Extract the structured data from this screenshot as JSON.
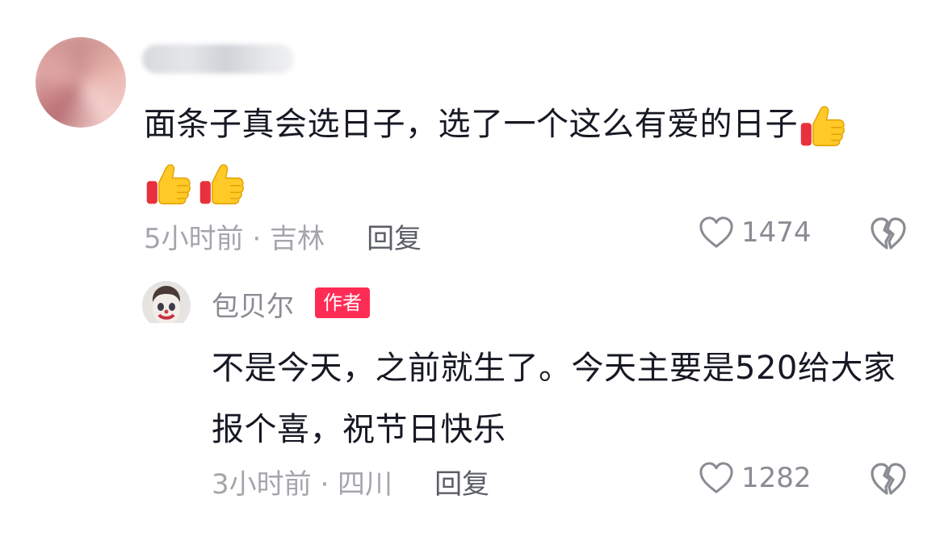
{
  "comment": {
    "text": "面条子真会选日子，选了一个这么有爱的日子",
    "emoji": [
      "thumbs-up",
      "thumbs-up",
      "thumbs-up"
    ],
    "time_location": "5小时前 · 吉林",
    "reply_label": "回复",
    "like_count": "1474"
  },
  "reply": {
    "username": "包贝尔",
    "badge": "作者",
    "text": "不是今天，之前就生了。今天主要是520给大家报个喜，祝节日快乐",
    "time_location": "3小时前 · 四川",
    "reply_label": "回复",
    "like_count": "1282"
  },
  "colors": {
    "badge_bg": "#fe2c55",
    "meta_gray": "#a4a6ac",
    "text": "#161823"
  },
  "icons": {
    "like": "heart-outline-icon",
    "dislike": "broken-heart-icon",
    "emoji": "thumbs-up-icon"
  }
}
